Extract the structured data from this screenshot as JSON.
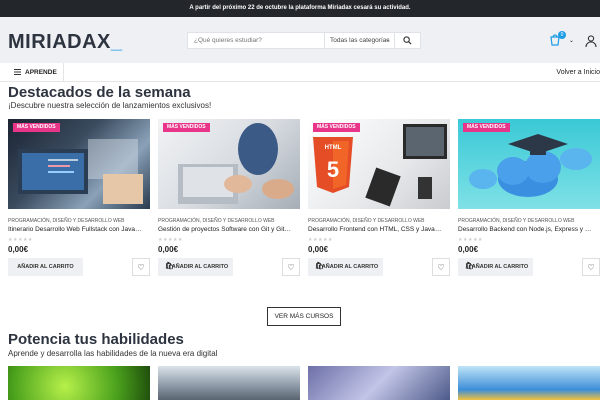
{
  "announcement": "A partir del próximo 22 de octubre la plataforma Miriadax cesará su actividad.",
  "header": {
    "logo": "MIRIADAX",
    "logo_cursor": "_",
    "search_placeholder": "¿Qué quieres estudiar?",
    "category_select": "Todas las categorías",
    "cart_count": "0"
  },
  "nav": {
    "apr": "APRENDE",
    "back": "Volver a Inicio"
  },
  "featured": {
    "title": "Destacados de la semana",
    "subtitle": "¡Descubre nuestra selección de lanzamientos exclusivos!",
    "cards": [
      {
        "tag": "MÁS VENDIDOS",
        "category": "PROGRAMACIÓN, DISEÑO Y DESARROLLO WEB",
        "name": "Itinerario Desarrollo Web Fullstack con JavaScript",
        "stars": "★★★★★",
        "price": "0,00€",
        "add": "AÑADIR AL CARRITO"
      },
      {
        "tag": "MÁS VENDIDOS",
        "category": "PROGRAMACIÓN, DISEÑO Y DESARROLLO WEB",
        "name": "Gestión de proyectos Software con Git y GitHub",
        "stars": "★★★★★",
        "price": "0,00€",
        "add": "AÑADIR AL CARRITO"
      },
      {
        "tag": "MÁS VENDIDOS",
        "category": "PROGRAMACIÓN, DISEÑO Y DESARROLLO WEB",
        "name": "Desarrollo Frontend con HTML, CSS y JavaScript",
        "stars": "★★★★★",
        "price": "0,00€",
        "add": "AÑADIR AL CARRITO"
      },
      {
        "tag": "MÁS VENDIDOS",
        "category": "PROGRAMACIÓN, DISEÑO Y DESARROLLO WEB",
        "name": "Desarrollo Backend con Node.js, Express y MongoDB",
        "stars": "★★★★★",
        "price": "0,00€",
        "add": "AÑADIR AL CARRITO"
      }
    ],
    "more": "VER MÁS CURSOS"
  },
  "skills": {
    "title": "Potencia tus habilidades",
    "subtitle": "Aprende y desarrolla las habilidades de la nueva era digital"
  },
  "colors": {
    "accent": "#1e9de6",
    "tag": "#e8358a",
    "dark": "#23262b"
  }
}
